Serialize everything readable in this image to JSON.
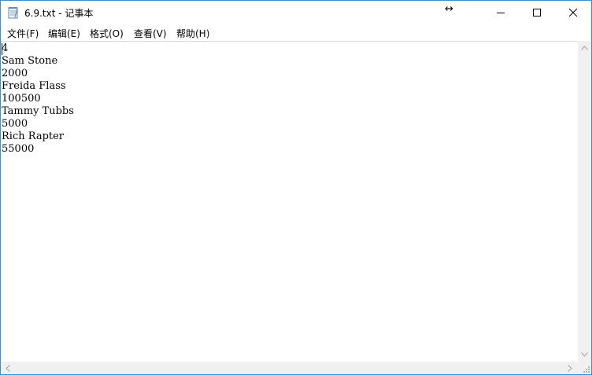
{
  "window": {
    "title": "6.9.txt - 记事本",
    "resize_cursor_glyph": "↔"
  },
  "menu": {
    "file": "文件(F)",
    "edit": "编辑(E)",
    "format": "格式(O)",
    "view": "查看(V)",
    "help": "帮助(H)"
  },
  "editor": {
    "content": "4\nSam Stone\n2000\nFreida Flass\n100500\nTammy Tubbs\n5000\nRich Rapter\n55000"
  },
  "colors": {
    "window_border": "#3c8dc9",
    "scrollbar_track": "#f0f0f0"
  },
  "icons": {
    "app": "notepad-icon",
    "minimize": "minimize-icon",
    "maximize": "maximize-icon",
    "close": "close-icon"
  }
}
